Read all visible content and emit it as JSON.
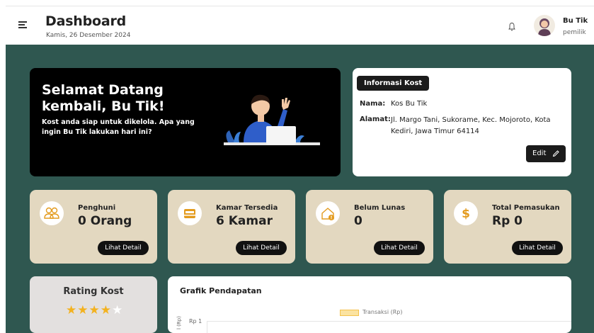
{
  "header": {
    "title": "Dashboard",
    "date": "Kamis, 26 Desember 2024",
    "user": {
      "name": "Bu Tik",
      "role": "pemilik"
    }
  },
  "welcome": {
    "title": "Selamat Datang kembali, Bu Tik!",
    "subtitle": "Kost anda siap untuk dikelola. Apa yang ingin Bu Tik lakukan hari ini?"
  },
  "info": {
    "heading": "Informasi Kost",
    "name_label": "Nama:",
    "name_value": "Kos Bu Tik",
    "address_label": "Alamat:",
    "address_value": "Jl. Margo Tani, Sukorame, Kec. Mojoroto, Kota Kediri, Jawa Timur 64114",
    "edit_label": "Edit"
  },
  "cards": [
    {
      "label": "Penghuni",
      "value": "0 Orang",
      "button": "Lihat Detail",
      "icon": "people-icon"
    },
    {
      "label": "Kamar Tersedia",
      "value": "6 Kamar",
      "button": "Lihat Detail",
      "icon": "bed-icon"
    },
    {
      "label": "Belum Lunas",
      "value": "0",
      "button": "Lihat Detail",
      "icon": "house-alert-icon"
    },
    {
      "label": "Total Pemasukan",
      "value": "Rp 0",
      "button": "Lihat Detail",
      "icon": "dollar-icon"
    }
  ],
  "rating": {
    "title": "Rating Kost",
    "stars_filled": 4,
    "stars_total": 5
  },
  "chart": {
    "title": "Grafik Pendapatan",
    "legend": "Transaksi (Rp)",
    "ylabel": "l (Rp)",
    "ytick_top": "Rp 1"
  },
  "colors": {
    "main_bg": "#2f5750",
    "card_bg": "#e3d8c0",
    "accent_yellow": "#f3b21f"
  }
}
